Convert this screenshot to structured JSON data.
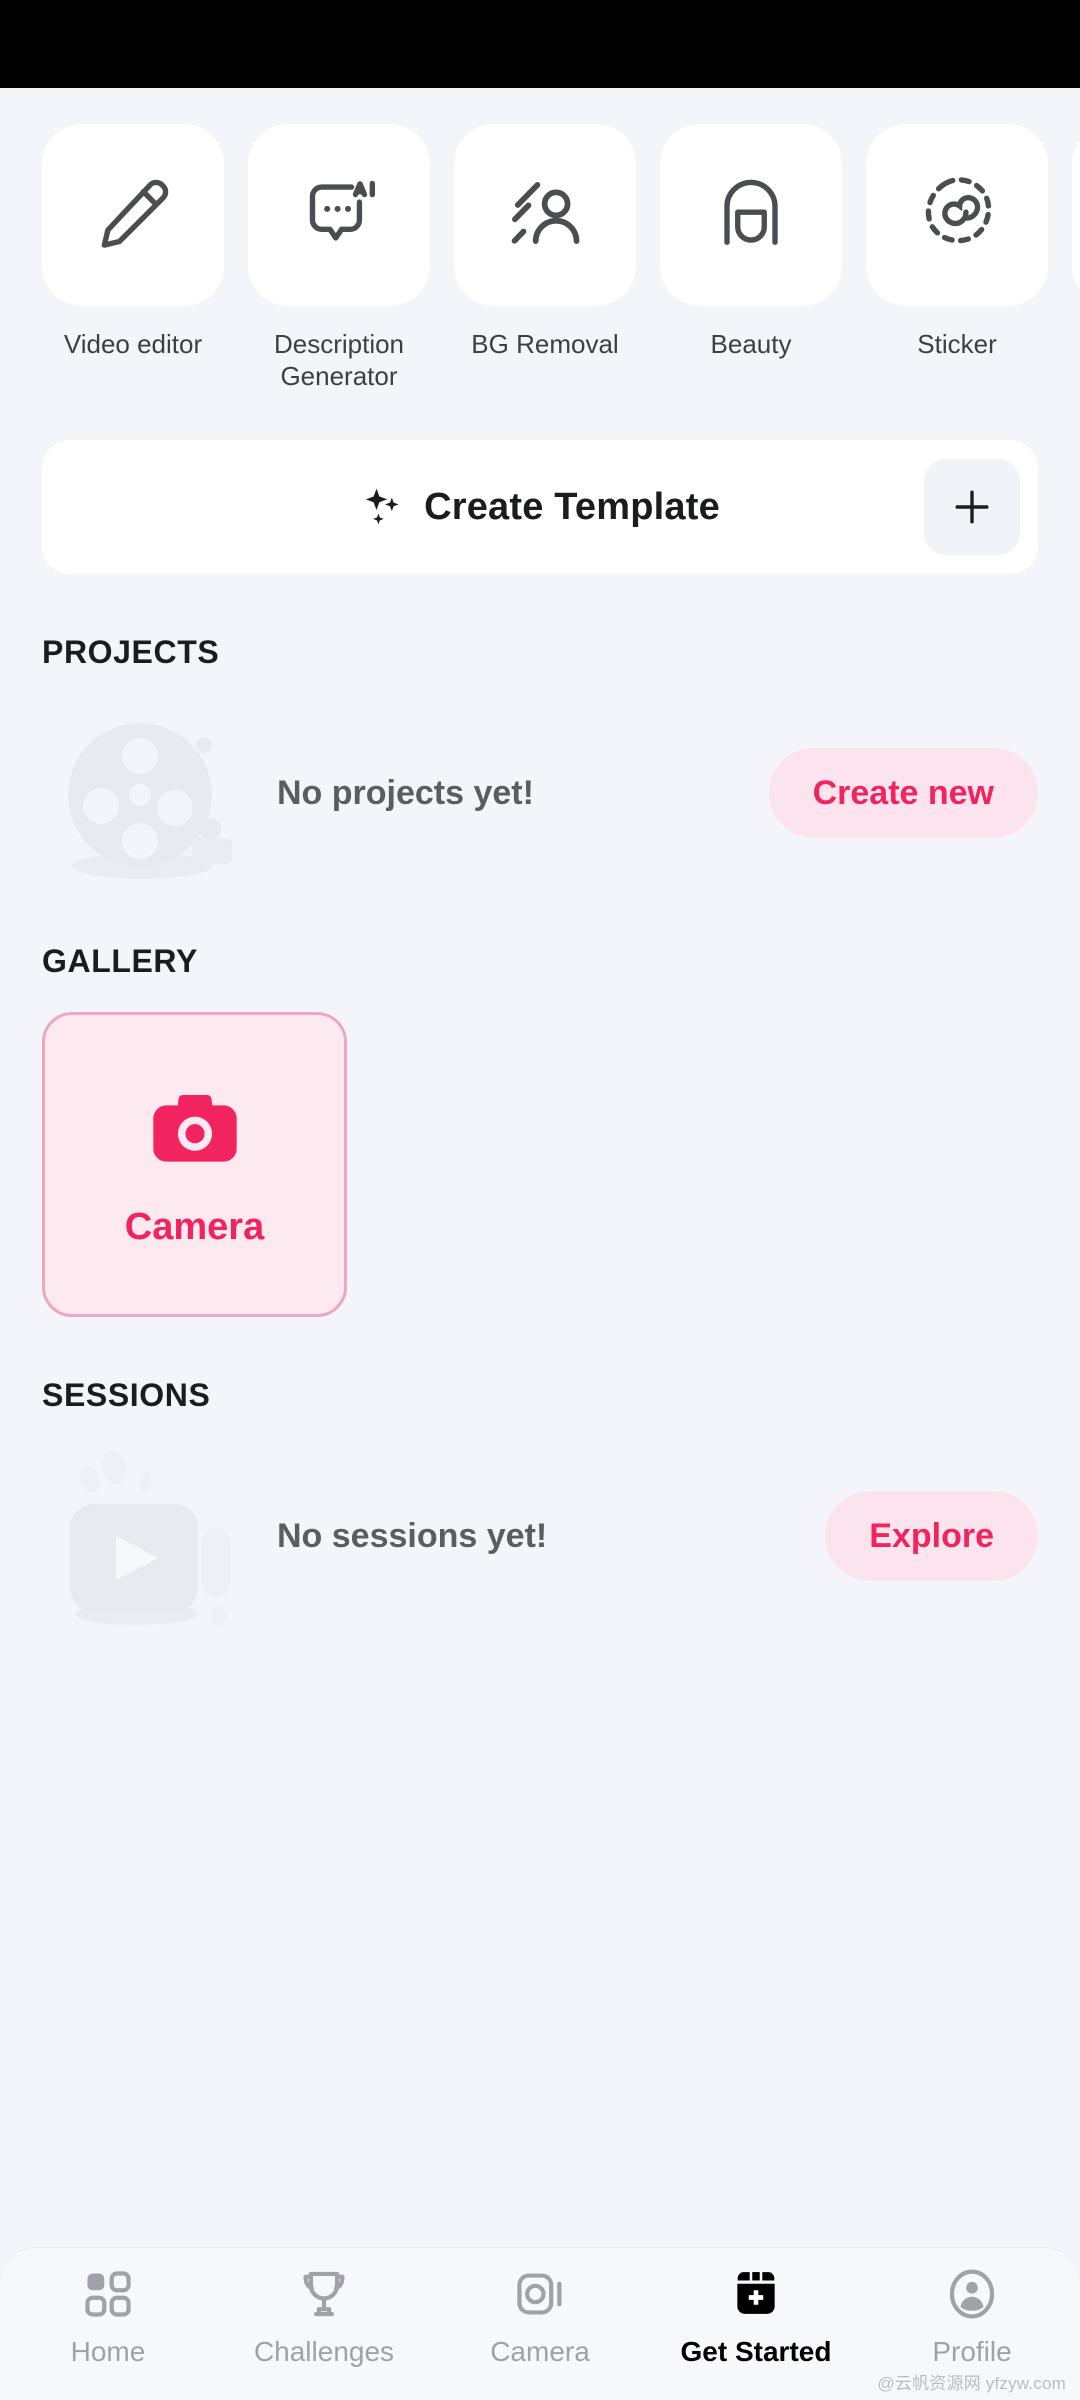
{
  "theme": {
    "page_bg": "#f4f5fa",
    "tile_bg": "#ffffff",
    "accent": "#f2245f",
    "accent_soft_bg": "#fce4ee",
    "camera_tile_bg": "#fdeaf1",
    "camera_tile_border": "#eda8c0",
    "nav_bg": "#f7f8fb",
    "nav_inactive": "#9fa2a9",
    "nav_active": "#000000",
    "icon_stroke": "#4a4d52",
    "empty_art": "#e7e9ef",
    "status_bar_bg": "#000000"
  },
  "tools": {
    "items": [
      {
        "label": "Video editor",
        "icon": "pencil-icon"
      },
      {
        "label": "Description\nGenerator",
        "icon": "ai-chat-bubble-icon"
      },
      {
        "label": "BG Removal",
        "icon": "person-background-removal-icon"
      },
      {
        "label": "Beauty",
        "icon": "face-beauty-icon"
      },
      {
        "label": "Sticker",
        "icon": "sticker-dashed-blob-icon"
      },
      {
        "label": "",
        "icon": "partial-tile-icon"
      }
    ]
  },
  "create_template": {
    "label": "Create Template",
    "sparkle_icon": "sparkles-icon",
    "add_button_icon": "plus-icon"
  },
  "projects": {
    "title": "PROJECTS",
    "empty_text": "No projects yet!",
    "action_label": "Create new",
    "art_icon": "film-reel-icon"
  },
  "gallery": {
    "title": "GALLERY",
    "tiles": [
      {
        "label": "Camera",
        "icon": "camera-icon"
      }
    ]
  },
  "sessions": {
    "title": "SESSIONS",
    "empty_text": "No sessions yet!",
    "action_label": "Explore",
    "art_icon": "video-play-icon"
  },
  "bottom_nav": {
    "items": [
      {
        "label": "Home",
        "icon": "grid-squares-icon",
        "active": false
      },
      {
        "label": "Challenges",
        "icon": "trophy-icon",
        "active": false
      },
      {
        "label": "Camera",
        "icon": "camera-outline-icon",
        "active": false
      },
      {
        "label": "Get Started",
        "icon": "calendar-plus-icon",
        "active": true
      },
      {
        "label": "Profile",
        "icon": "profile-avatar-icon",
        "active": false
      }
    ]
  },
  "watermark": {
    "text": "@云帆资源网 yfzyw.com"
  }
}
